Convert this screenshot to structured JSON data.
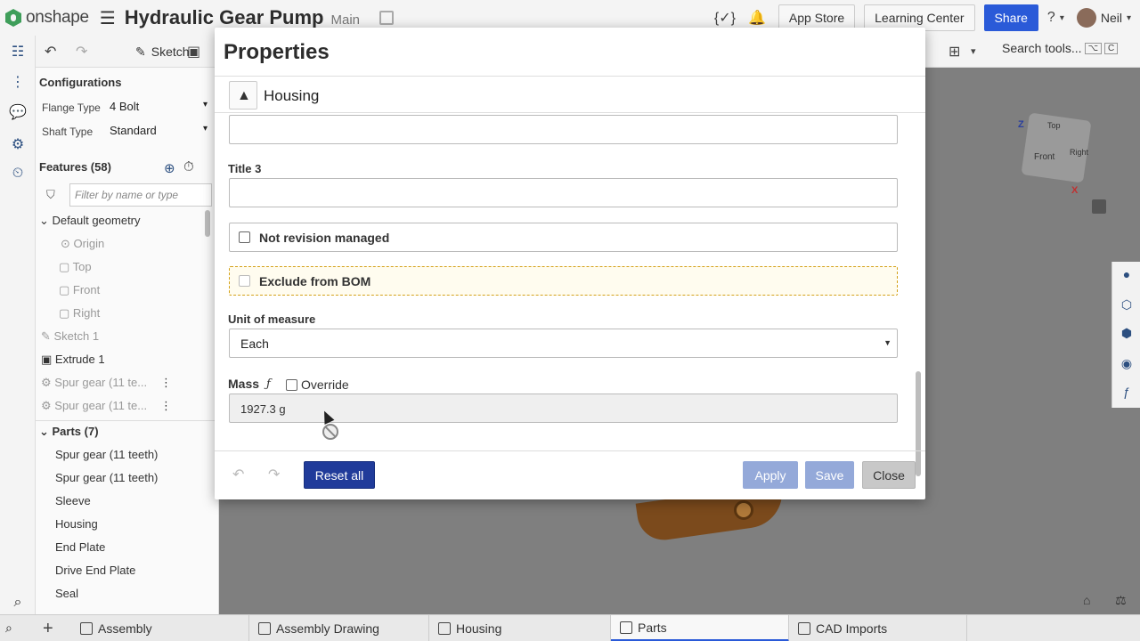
{
  "app": {
    "logo_text": "onshape",
    "doc_title": "Hydraulic Gear Pump",
    "branch": "Main"
  },
  "header": {
    "app_store": "App Store",
    "learning_center": "Learning Center",
    "share": "Share",
    "user_name": "Neil"
  },
  "toolbar": {
    "sketch_label": "Sketch",
    "search_label": "Search tools...",
    "search_kbd": [
      "⌥",
      "C"
    ]
  },
  "configurations": {
    "title": "Configurations",
    "rows": [
      {
        "label": "Flange Type",
        "value": "4 Bolt"
      },
      {
        "label": "Shaft Type",
        "value": "Standard"
      }
    ]
  },
  "features": {
    "title": "Features (58)",
    "filter_placeholder": "Filter by name or type",
    "items": [
      "Default geometry",
      "Origin",
      "Top",
      "Front",
      "Right",
      "Sketch 1",
      "Extrude 1",
      "Spur gear (11 te...",
      "Spur gear (11 te..."
    ]
  },
  "parts": {
    "title": "Parts (7)",
    "items": [
      "Spur gear (11 teeth)",
      "Spur gear (11 teeth)",
      "Sleeve",
      "Housing",
      "End Plate",
      "Drive End Plate",
      "Seal"
    ]
  },
  "viewcube": {
    "front": "Front",
    "top": "Top",
    "right": "Right",
    "z": "Z",
    "x": "X"
  },
  "tabs": [
    "Assembly",
    "Assembly Drawing",
    "Housing",
    "Parts",
    "CAD Imports"
  ],
  "dialog": {
    "title": "Properties",
    "part_name": "Housing",
    "title3_label": "Title 3",
    "not_revision_managed": "Not revision managed",
    "exclude_bom": "Exclude from BOM",
    "unit_label": "Unit of measure",
    "unit_value": "Each",
    "mass_label": "Mass",
    "fx": "ƒ",
    "override_label": "Override",
    "mass_value": "1927.3 g",
    "reset_all": "Reset all",
    "apply": "Apply",
    "save": "Save",
    "close": "Close"
  },
  "colors": {
    "accent": "#2a5ad8",
    "reset_button": "#203b9a",
    "disabled_button": "#94a9d9",
    "focus_border": "#d4a21a"
  }
}
